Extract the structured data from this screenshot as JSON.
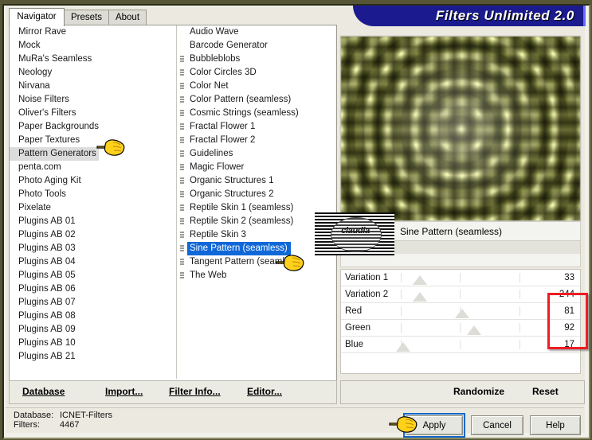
{
  "window": {
    "banner_title": "Filters Unlimited 2.0"
  },
  "tabs": [
    {
      "label": "Navigator",
      "active": true
    },
    {
      "label": "Presets",
      "active": false
    },
    {
      "label": "About",
      "active": false
    }
  ],
  "categories": {
    "selected": "Pattern Generators",
    "items": [
      "Mirror Rave",
      "Mock",
      "MuRa's Seamless",
      "Neology",
      "Nirvana",
      "Noise Filters",
      "Oliver's Filters",
      "Paper Backgrounds",
      "Paper Textures",
      "Pattern Generators",
      "penta.com",
      "Photo Aging Kit",
      "Photo Tools",
      "Pixelate",
      "Plugins AB 01",
      "Plugins AB 02",
      "Plugins AB 03",
      "Plugins AB 04",
      "Plugins AB 05",
      "Plugins AB 06",
      "Plugins AB 07",
      "Plugins AB 08",
      "Plugins AB 09",
      "Plugins AB 10",
      "Plugins AB 21"
    ]
  },
  "filters": {
    "selected": "Sine Pattern (seamless)",
    "items": [
      {
        "label": "Audio Wave",
        "glyph": false
      },
      {
        "label": "Barcode Generator",
        "glyph": false
      },
      {
        "label": "Bubbleblobs",
        "glyph": true
      },
      {
        "label": "Color Circles 3D",
        "glyph": true
      },
      {
        "label": "Color Net",
        "glyph": true
      },
      {
        "label": "Color Pattern (seamless)",
        "glyph": true
      },
      {
        "label": "Cosmic Strings (seamless)",
        "glyph": true
      },
      {
        "label": "Fractal Flower 1",
        "glyph": true
      },
      {
        "label": "Fractal Flower 2",
        "glyph": true
      },
      {
        "label": "Guidelines",
        "glyph": true
      },
      {
        "label": "Magic Flower",
        "glyph": true
      },
      {
        "label": "Organic Structures 1",
        "glyph": true
      },
      {
        "label": "Organic Structures 2",
        "glyph": true
      },
      {
        "label": "Reptile Skin 1 (seamless)",
        "glyph": true
      },
      {
        "label": "Reptile Skin 2 (seamless)",
        "glyph": true
      },
      {
        "label": "Reptile Skin 3",
        "glyph": true
      },
      {
        "label": "Sine Pattern (seamless)",
        "glyph": true
      },
      {
        "label": "Tangent Pattern (seamless)",
        "glyph": true
      },
      {
        "label": "The Web",
        "glyph": true
      }
    ]
  },
  "list_toolbar": {
    "database": "Database",
    "import": "Import...",
    "filter_info": "Filter Info...",
    "editor": "Editor..."
  },
  "status": {
    "database_label": "Database:",
    "database_value": "ICNET-Filters",
    "filters_label": "Filters:",
    "filters_value": "4467"
  },
  "preview": {
    "filter_name": "Sine Pattern (seamless)",
    "watermark": "claudia"
  },
  "parameters": [
    {
      "name": "Variation 1",
      "value": "33",
      "thumb_pct": 13
    },
    {
      "name": "Variation 2",
      "value": "244",
      "thumb_pct": 13
    },
    {
      "name": "Red",
      "value": "81",
      "thumb_pct": 31
    },
    {
      "name": "Green",
      "value": "92",
      "thumb_pct": 36
    },
    {
      "name": "Blue",
      "value": "17",
      "thumb_pct": 6
    }
  ],
  "param_actions": {
    "randomize": "Randomize",
    "reset": "Reset"
  },
  "dialog_buttons": {
    "apply": "Apply",
    "cancel": "Cancel",
    "help": "Help"
  },
  "colors": {
    "banner_blue": "#1b1b8f",
    "selection_blue": "#1068d8",
    "annotation_red": "#ee1c25",
    "frame_olive": "#565636",
    "preview_olive": "#8b8d66"
  }
}
